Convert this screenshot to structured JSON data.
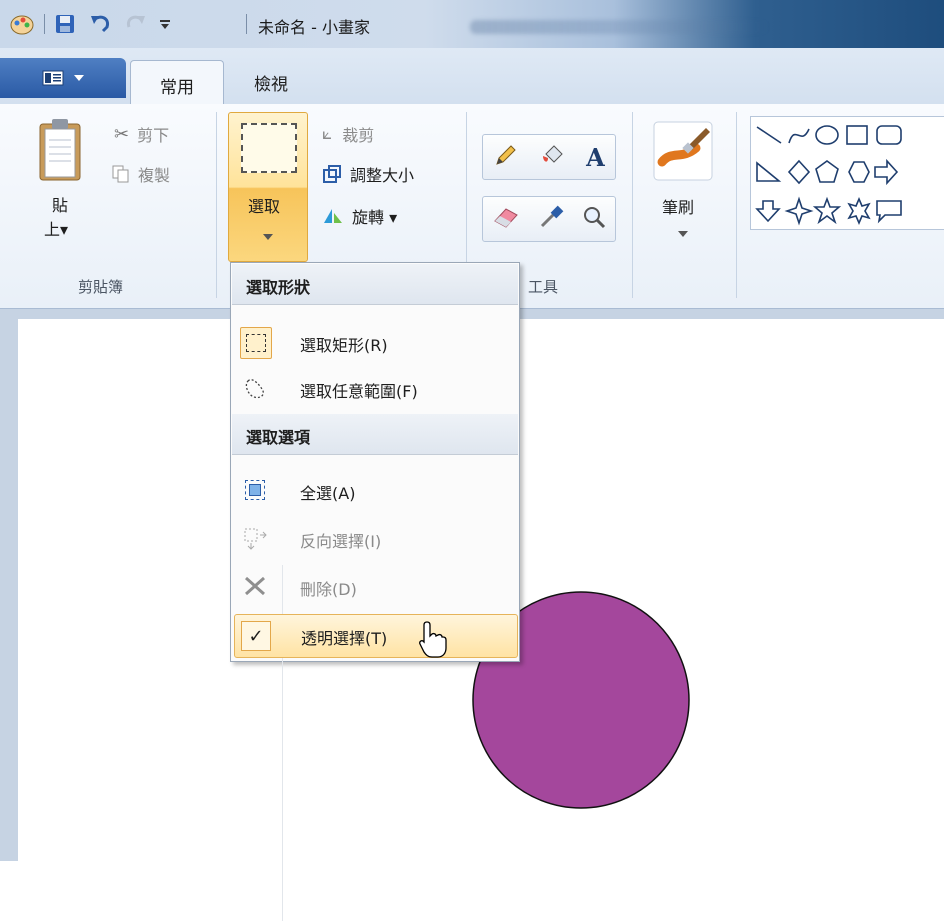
{
  "window": {
    "title": "未命名 - 小畫家"
  },
  "ribbon_tabs": [
    {
      "label": "常用",
      "active": true
    },
    {
      "label": "檢視",
      "active": false
    }
  ],
  "clipboard": {
    "paste_top": "貼",
    "paste_bottom": "上▾",
    "cut": "剪下",
    "copy": "複製",
    "group_label": "剪貼簿"
  },
  "image": {
    "select_label": "選取",
    "crop": "裁剪",
    "resize": "調整大小",
    "rotate": "旋轉 ▾"
  },
  "tools": {
    "group_label": "工具"
  },
  "brushes": {
    "label": "筆刷"
  },
  "select_menu": {
    "shape_header": "選取形狀",
    "rect": "選取矩形(R)",
    "free": "選取任意範圍(F)",
    "options_header": "選取選項",
    "select_all": "全選(A)",
    "invert": "反向選擇(I)",
    "delete": "刪除(D)",
    "transparent": "透明選擇(T)",
    "transparent_checked": true
  },
  "colors": {
    "circle_fill": "#a4479c",
    "accent": "#f5b93d",
    "file_tab": "#2c5ea8"
  }
}
